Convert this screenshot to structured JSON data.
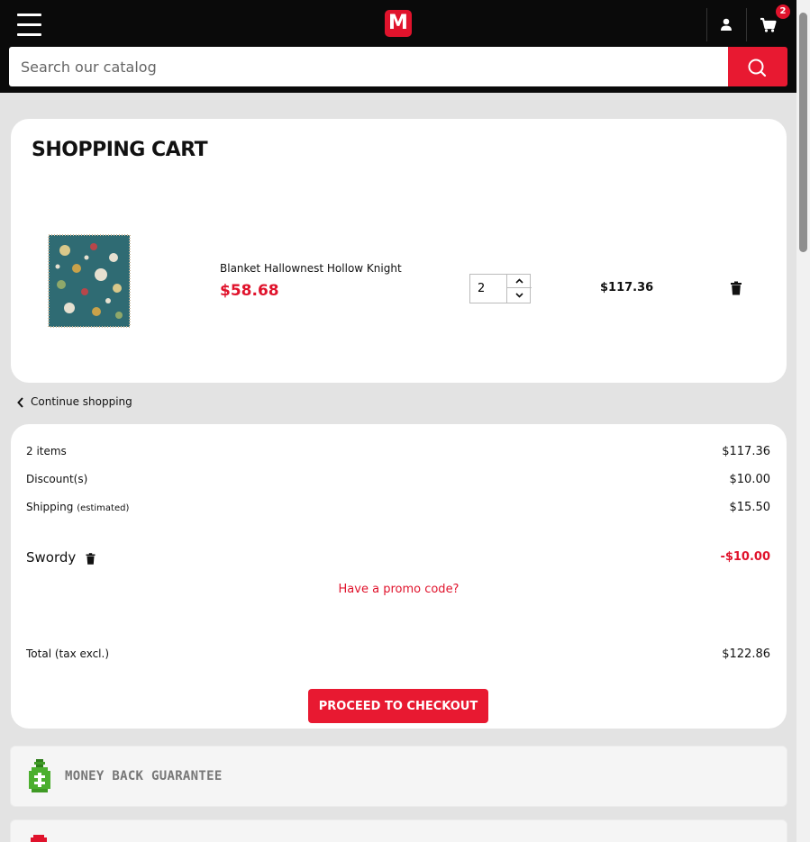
{
  "header": {
    "logo_letter": "M",
    "cart_count": "2",
    "search_placeholder": "Search our catalog"
  },
  "cart": {
    "title": "SHOPPING CART",
    "items": [
      {
        "name": "Blanket Hallownest Hollow Knight",
        "unit_price": "$58.68",
        "quantity": "2",
        "line_total": "$117.36"
      }
    ]
  },
  "continue_shopping": "Continue shopping",
  "summary": {
    "items_label": "2 items",
    "items_value": "$117.36",
    "discount_label": "Discount(s)",
    "discount_value": "$10.00",
    "shipping_label": "Shipping",
    "shipping_note": "(estimated)",
    "shipping_value": "$15.50",
    "voucher_name": "Swordy",
    "voucher_value": "-$10.00",
    "promo_link": "Have a promo code?",
    "total_label": "Total",
    "total_note": "(tax excl.)",
    "total_value": "$122.86",
    "checkout_label": "PROCEED TO CHECKOUT"
  },
  "reassurance": [
    {
      "label": "MONEY BACK GUARANTEE",
      "icon": "money-bag-icon"
    },
    {
      "label": "",
      "icon": "badge-icon"
    }
  ],
  "colors": {
    "accent": "#e81931",
    "header_bg": "#0a0a0a",
    "page_bg": "#e3e3e3"
  }
}
